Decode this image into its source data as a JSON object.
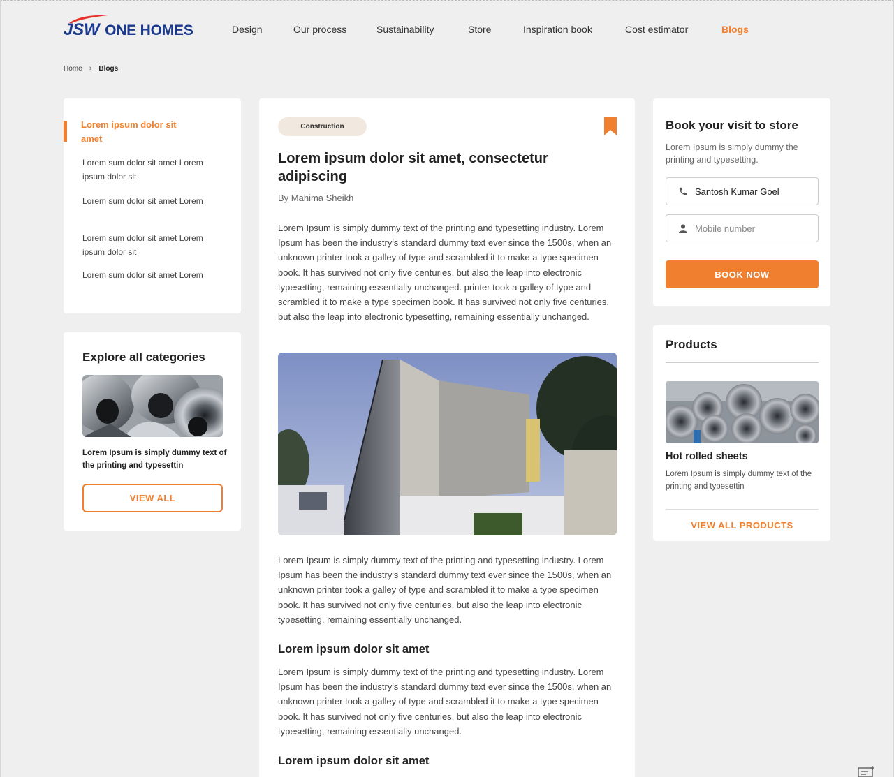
{
  "brand": {
    "logo_jsw": "JSW",
    "logo_one": "ONE",
    "logo_homes": "HOMES",
    "accent": "#f08030",
    "brand_blue": "#1b3a8c"
  },
  "nav": {
    "items": [
      {
        "label": "Design"
      },
      {
        "label": "Our process"
      },
      {
        "label": "Sustainability"
      },
      {
        "label": "Store"
      },
      {
        "label": "Inspiration book"
      },
      {
        "label": "Cost estimator"
      },
      {
        "label": "Blogs",
        "active": true
      }
    ]
  },
  "breadcrumb": {
    "home": "Home",
    "current": "Blogs"
  },
  "toc": {
    "active": "Lorem ipsum dolor sit amet",
    "items": [
      "Lorem sum dolor sit amet Lorem ipsum dolor sit",
      "Lorem sum dolor sit amet Lorem",
      "Lorem sum dolor sit amet Lorem ipsum dolor sit",
      "Lorem sum dolor sit amet Lorem"
    ]
  },
  "explore": {
    "title": "Explore all categories",
    "caption": "Lorem Ipsum is simply dummy text of the printing and typesettin",
    "button": "VIEW ALL"
  },
  "article": {
    "tag": "Construction",
    "title": "Lorem ipsum dolor sit amet, consectetur adipiscing",
    "author": "By Mahima Sheikh",
    "para1": "Lorem Ipsum is simply dummy text of the printing and typesetting industry. Lorem Ipsum has been the industry's standard dummy text ever since the 1500s, when an unknown printer took a galley of type and scrambled it to make a type specimen book. It has survived not only five centuries, but also the leap into electronic typesetting, remaining essentially unchanged. printer took a galley of type and scrambled it to make a type specimen book. It has survived not only five centuries, but also the leap into electronic typesetting, remaining essentially unchanged.",
    "para2": "Lorem Ipsum is simply dummy text of the printing and typesetting industry. Lorem Ipsum has been the industry's standard dummy text ever since the 1500s, when an unknown printer took a galley of type and scrambled it to make a type specimen book. It has survived not only five centuries, but also the leap into electronic typesetting, remaining essentially unchanged.",
    "heading1": "Lorem ipsum dolor sit amet",
    "para3": "Lorem Ipsum is simply dummy text of the printing and typesetting industry. Lorem Ipsum has been the industry's standard dummy text ever since the 1500s, when an unknown printer took a galley of type and scrambled it to make a type specimen book. It has survived not only five centuries, but also the leap into electronic typesetting, remaining essentially unchanged.",
    "heading2": "Lorem ipsum dolor sit amet"
  },
  "book": {
    "title": "Book your visit to store",
    "desc": "Lorem Ipsum is simply dummy  the printing and typesetting.",
    "name_value": "Santosh Kumar Goel",
    "mobile_placeholder": "Mobile number",
    "button": "BOOK NOW"
  },
  "products": {
    "title": "Products",
    "item_name": "Hot rolled sheets",
    "item_desc": "Lorem Ipsum is simply dummy text of the printing and typesettin",
    "link": "VIEW ALL PRODUCTS"
  },
  "icons": {
    "bookmark": "bookmark-icon",
    "phone": "phone-icon",
    "user": "user-icon",
    "chevron": "chevron-right-icon",
    "corner": "add-note-icon"
  }
}
